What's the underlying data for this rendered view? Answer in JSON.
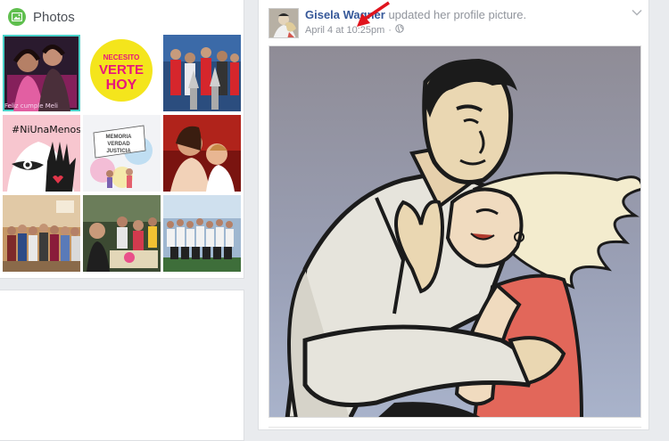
{
  "photos": {
    "title": "Photos",
    "thumbnails": [
      {
        "name": "thumb-friends-neon",
        "caption": "Feliz cumple Meli"
      },
      {
        "name": "thumb-necesito-verte-hoy",
        "text_lines": [
          "NECESITO",
          "VERTE",
          "HOY"
        ]
      },
      {
        "name": "thumb-trophy-group"
      },
      {
        "name": "thumb-ni-una-menos",
        "text": "#NiUnaMenos"
      },
      {
        "name": "thumb-memoria-verdad-justicia",
        "text_lines": [
          "MEMORIA",
          "VERDAD",
          "JUSTICIA"
        ]
      },
      {
        "name": "thumb-mother-child"
      },
      {
        "name": "thumb-family-gathering"
      },
      {
        "name": "thumb-kids-party"
      },
      {
        "name": "thumb-team-photo"
      }
    ]
  },
  "post": {
    "author": "Gisela Wagner",
    "action": "updated her profile picture.",
    "timestamp": "April 4 at 10:25pm",
    "separator": "·",
    "privacy_icon": "globe-icon"
  },
  "colors": {
    "link": "#365899",
    "meta": "#90949c",
    "photos_icon": "#5fbf4e",
    "annotation_arrow": "#e0141e"
  }
}
